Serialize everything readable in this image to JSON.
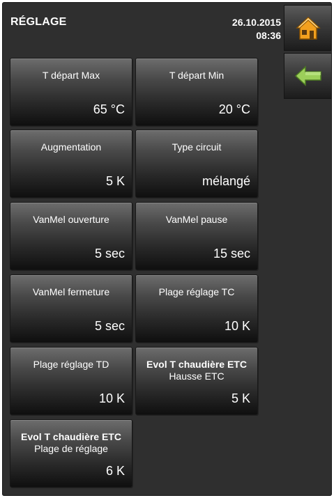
{
  "header": {
    "title": "RÉGLAGE",
    "date": "26.10.2015",
    "time": "08:36"
  },
  "nav": {
    "home_icon": "home-icon",
    "back_icon": "back-arrow-icon",
    "home_color": "#f2a01e",
    "back_color": "#9ccf5a"
  },
  "tiles": [
    {
      "label": "T départ Max",
      "value": "65 °C"
    },
    {
      "label": "T départ Min",
      "value": "20 °C"
    },
    {
      "label": "Augmentation",
      "value": "5 K"
    },
    {
      "label": "Type circuit",
      "value": "mélangé"
    },
    {
      "label": "VanMel ouverture",
      "value": "5 sec"
    },
    {
      "label": "VanMel pause",
      "value": "15 sec"
    },
    {
      "label": "VanMel fermeture",
      "value": "5 sec"
    },
    {
      "label": "Plage réglage TC",
      "value": "10 K"
    },
    {
      "label": "Plage réglage TD",
      "value": "10 K"
    },
    {
      "label": "Evol T chaudière ETC",
      "sublabel": "Hausse ETC",
      "value": "5 K"
    },
    {
      "label": "Evol T chaudière ETC",
      "sublabel": "Plage de réglage",
      "value": "6 K"
    }
  ]
}
